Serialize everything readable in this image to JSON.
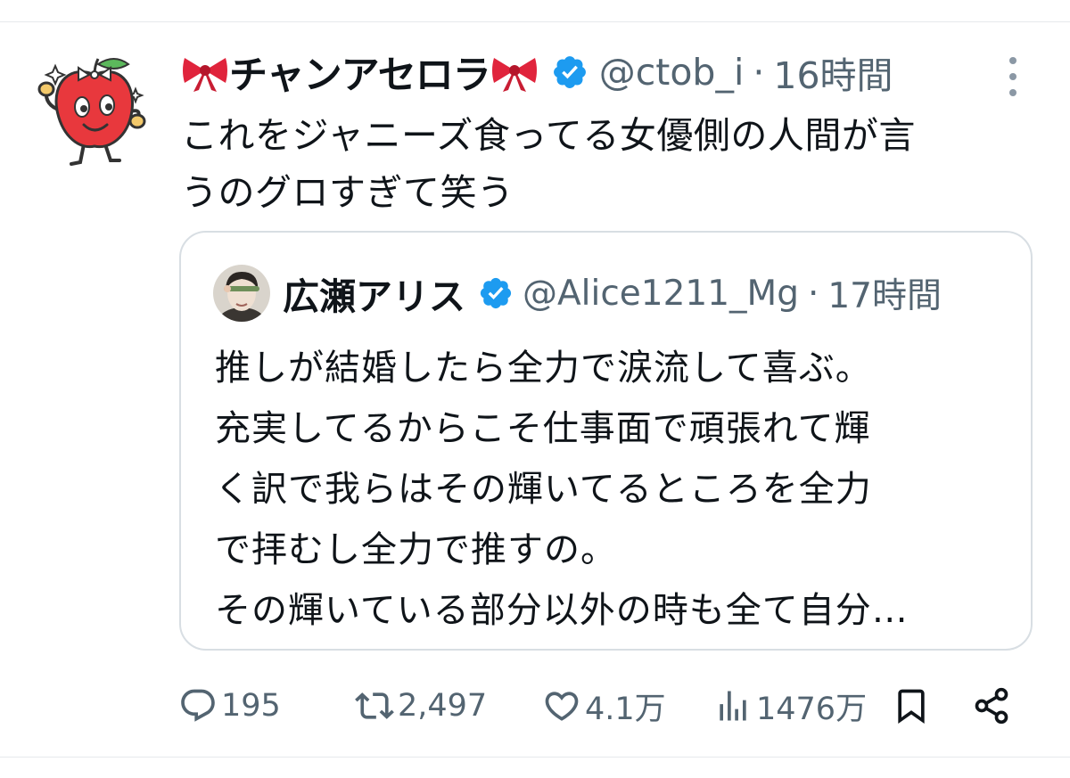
{
  "tweet": {
    "author_name": "チャンアセロラ",
    "handle": "@ctob_i",
    "separator": "·",
    "time": "16時間",
    "text_lines": [
      "これをジャニーズ食ってる女優側の人間が言",
      "うのグロすぎて笑う"
    ]
  },
  "quote": {
    "author_name": "広瀬アリス",
    "handle": "@Alice1211_Mg",
    "separator": "·",
    "time": "17時間",
    "text_lines": [
      "推しが結婚したら全力で涙流して喜ぶ。",
      "充実してるからこそ仕事面で頑張れて輝",
      "く訳で我らはその輝いてるところを全力",
      "で拝むし全力で推すの。",
      "その輝いている部分以外の時も全て自分…"
    ]
  },
  "actions": {
    "replies": "195",
    "retweets": "2,497",
    "likes": "4.1万",
    "views": "1476万"
  },
  "icons": {
    "verified": "verified-badge-icon",
    "bow": "ribbon-bow-emoji",
    "more": "more-vertical-icon",
    "reply": "reply-icon",
    "retweet": "retweet-icon",
    "like": "heart-icon",
    "views": "views-chart-icon",
    "bookmark": "bookmark-icon",
    "share": "share-icon"
  },
  "colors": {
    "text": "#0f1419",
    "muted": "#536471",
    "verified": "#1d9bf0",
    "border": "#d8dee3",
    "bow": "#e0243c"
  }
}
